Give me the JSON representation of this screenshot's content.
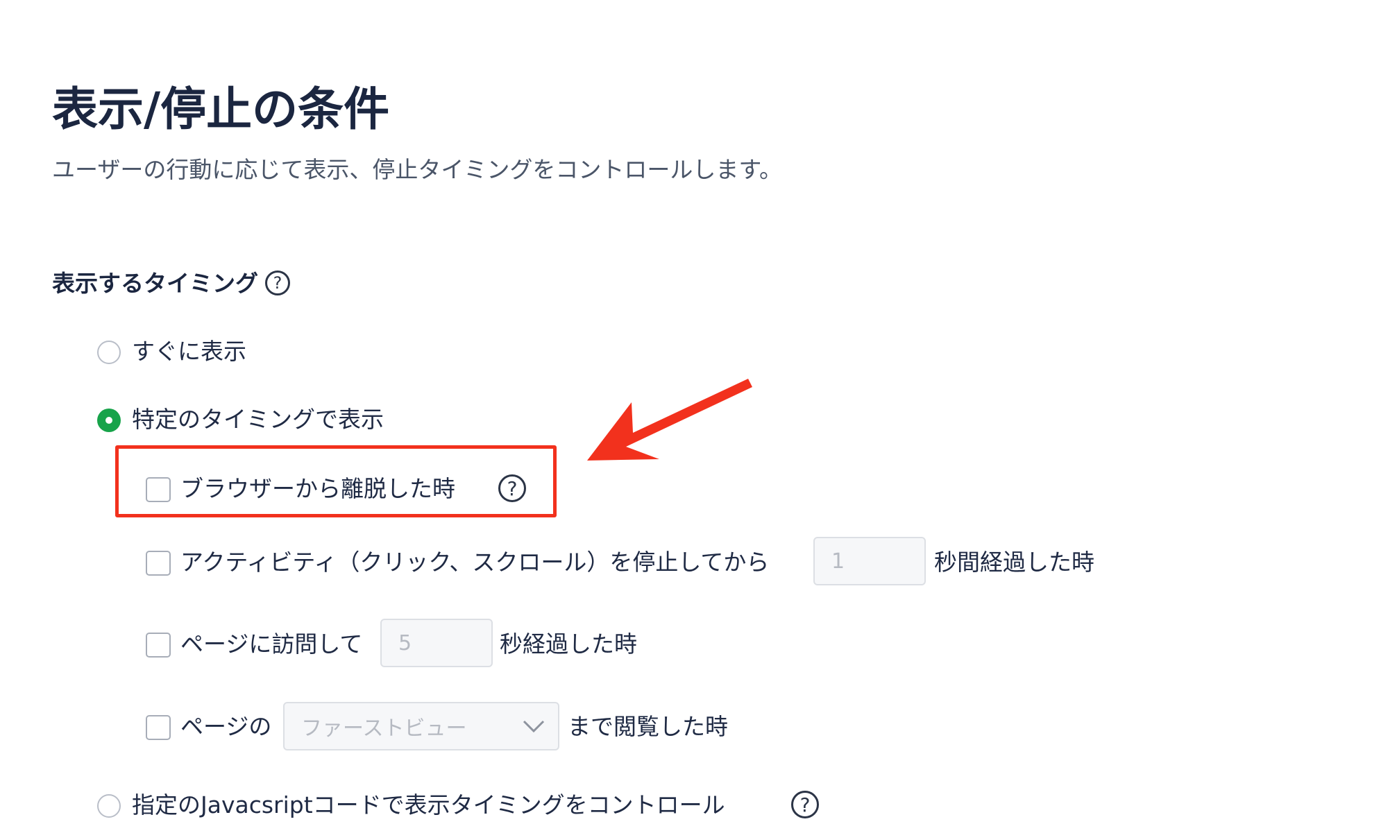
{
  "page": {
    "title": "表示/停止の条件",
    "subtitle": "ユーザーの行動に応じて表示、停止タイミングをコントロールします。"
  },
  "display_timing": {
    "heading": "表示するタイミング",
    "options": [
      {
        "label": "すぐに表示",
        "selected": false
      },
      {
        "label": "特定のタイミングで表示",
        "selected": true
      },
      {
        "label": "指定のJavacsriptコードで表示タイミングをコントロール",
        "selected": false
      }
    ],
    "conditions": {
      "browser_leave": {
        "label": "ブラウザーから離脱した時",
        "checked": false
      },
      "inactivity": {
        "label_before": "アクティビティ（クリック、スクロール）を停止してから",
        "value": "1",
        "label_after": "秒間経過した時",
        "checked": false
      },
      "page_visit": {
        "label_before": "ページに訪問して",
        "value": "5",
        "label_after": "秒経過した時",
        "checked": false
      },
      "page_scroll": {
        "label_before": "ページの",
        "selected_option": "ファーストビュー",
        "label_after": "まで閲覧した時",
        "checked": false
      }
    }
  },
  "annotation": {
    "highlight_color": "#f2311d"
  },
  "icons": {
    "help": "question-circle-icon",
    "select_arrow": "chevron-down-icon",
    "annotation_arrow": "arrow-icon"
  }
}
